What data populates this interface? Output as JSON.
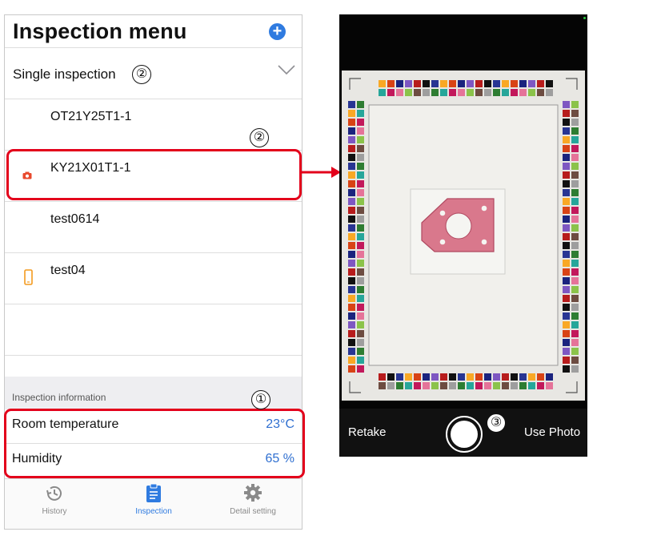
{
  "app": {
    "title": "Inspection menu",
    "add_symbol": "+"
  },
  "dropdown": {
    "label": "Single inspection",
    "marker": "②"
  },
  "list": {
    "items": [
      {
        "label": "OT21Y25T1-1",
        "icon": ""
      },
      {
        "label": "KY21X01T1-1",
        "icon": "camera-icon"
      },
      {
        "label": "test0614",
        "icon": ""
      },
      {
        "label": "test04",
        "icon": "phone-icon"
      },
      {
        "label": "",
        "icon": ""
      }
    ]
  },
  "info": {
    "header": "Inspection information",
    "temperature_label": "Room temperature",
    "temperature_value": "23°C",
    "humidity_label": "Humidity",
    "humidity_value": "65 %"
  },
  "tabs": [
    {
      "label": "History",
      "icon": "history-icon",
      "active": false
    },
    {
      "label": "Inspection",
      "icon": "clipboard-icon",
      "active": true
    },
    {
      "label": "Detail setting",
      "icon": "gear-icon",
      "active": false
    }
  ],
  "annotations": {
    "marker_1": "①",
    "marker_2": "②",
    "marker_3": "③"
  },
  "camera": {
    "retake_label": "Retake",
    "use_photo_label": "Use Photo"
  },
  "colors": {
    "accent": "#2f7be0",
    "highlight": "#e3001b",
    "value_text": "#2f6fd0",
    "camera_bg": "#050505"
  }
}
